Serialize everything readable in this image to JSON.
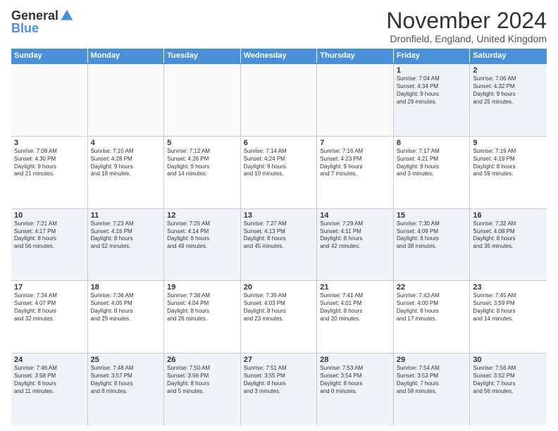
{
  "logo": {
    "general": "General",
    "blue": "Blue"
  },
  "title": "November 2024",
  "location": "Dronfield, England, United Kingdom",
  "days_of_week": [
    "Sunday",
    "Monday",
    "Tuesday",
    "Wednesday",
    "Thursday",
    "Friday",
    "Saturday"
  ],
  "rows": [
    {
      "cells": [
        {
          "day": "",
          "empty": true,
          "lines": []
        },
        {
          "day": "",
          "empty": true,
          "lines": []
        },
        {
          "day": "",
          "empty": true,
          "lines": []
        },
        {
          "day": "",
          "empty": true,
          "lines": []
        },
        {
          "day": "",
          "empty": true,
          "lines": []
        },
        {
          "day": "1",
          "empty": false,
          "lines": [
            "Sunrise: 7:04 AM",
            "Sunset: 4:34 PM",
            "Daylight: 9 hours",
            "and 29 minutes."
          ]
        },
        {
          "day": "2",
          "empty": false,
          "lines": [
            "Sunrise: 7:06 AM",
            "Sunset: 4:32 PM",
            "Daylight: 9 hours",
            "and 25 minutes."
          ]
        }
      ]
    },
    {
      "cells": [
        {
          "day": "3",
          "empty": false,
          "lines": [
            "Sunrise: 7:08 AM",
            "Sunset: 4:30 PM",
            "Daylight: 9 hours",
            "and 21 minutes."
          ]
        },
        {
          "day": "4",
          "empty": false,
          "lines": [
            "Sunrise: 7:10 AM",
            "Sunset: 4:28 PM",
            "Daylight: 9 hours",
            "and 18 minutes."
          ]
        },
        {
          "day": "5",
          "empty": false,
          "lines": [
            "Sunrise: 7:12 AM",
            "Sunset: 4:26 PM",
            "Daylight: 9 hours",
            "and 14 minutes."
          ]
        },
        {
          "day": "6",
          "empty": false,
          "lines": [
            "Sunrise: 7:14 AM",
            "Sunset: 4:24 PM",
            "Daylight: 9 hours",
            "and 10 minutes."
          ]
        },
        {
          "day": "7",
          "empty": false,
          "lines": [
            "Sunrise: 7:16 AM",
            "Sunset: 4:23 PM",
            "Daylight: 9 hours",
            "and 7 minutes."
          ]
        },
        {
          "day": "8",
          "empty": false,
          "lines": [
            "Sunrise: 7:17 AM",
            "Sunset: 4:21 PM",
            "Daylight: 9 hours",
            "and 3 minutes."
          ]
        },
        {
          "day": "9",
          "empty": false,
          "lines": [
            "Sunrise: 7:19 AM",
            "Sunset: 4:19 PM",
            "Daylight: 8 hours",
            "and 59 minutes."
          ]
        }
      ]
    },
    {
      "cells": [
        {
          "day": "10",
          "empty": false,
          "lines": [
            "Sunrise: 7:21 AM",
            "Sunset: 4:17 PM",
            "Daylight: 8 hours",
            "and 56 minutes."
          ]
        },
        {
          "day": "11",
          "empty": false,
          "lines": [
            "Sunrise: 7:23 AM",
            "Sunset: 4:16 PM",
            "Daylight: 8 hours",
            "and 52 minutes."
          ]
        },
        {
          "day": "12",
          "empty": false,
          "lines": [
            "Sunrise: 7:25 AM",
            "Sunset: 4:14 PM",
            "Daylight: 8 hours",
            "and 49 minutes."
          ]
        },
        {
          "day": "13",
          "empty": false,
          "lines": [
            "Sunrise: 7:27 AM",
            "Sunset: 4:13 PM",
            "Daylight: 8 hours",
            "and 45 minutes."
          ]
        },
        {
          "day": "14",
          "empty": false,
          "lines": [
            "Sunrise: 7:29 AM",
            "Sunset: 4:11 PM",
            "Daylight: 8 hours",
            "and 42 minutes."
          ]
        },
        {
          "day": "15",
          "empty": false,
          "lines": [
            "Sunrise: 7:30 AM",
            "Sunset: 4:09 PM",
            "Daylight: 8 hours",
            "and 38 minutes."
          ]
        },
        {
          "day": "16",
          "empty": false,
          "lines": [
            "Sunrise: 7:32 AM",
            "Sunset: 4:08 PM",
            "Daylight: 8 hours",
            "and 35 minutes."
          ]
        }
      ]
    },
    {
      "cells": [
        {
          "day": "17",
          "empty": false,
          "lines": [
            "Sunrise: 7:34 AM",
            "Sunset: 4:07 PM",
            "Daylight: 8 hours",
            "and 32 minutes."
          ]
        },
        {
          "day": "18",
          "empty": false,
          "lines": [
            "Sunrise: 7:36 AM",
            "Sunset: 4:05 PM",
            "Daylight: 8 hours",
            "and 29 minutes."
          ]
        },
        {
          "day": "19",
          "empty": false,
          "lines": [
            "Sunrise: 7:38 AM",
            "Sunset: 4:04 PM",
            "Daylight: 8 hours",
            "and 26 minutes."
          ]
        },
        {
          "day": "20",
          "empty": false,
          "lines": [
            "Sunrise: 7:39 AM",
            "Sunset: 4:03 PM",
            "Daylight: 8 hours",
            "and 23 minutes."
          ]
        },
        {
          "day": "21",
          "empty": false,
          "lines": [
            "Sunrise: 7:41 AM",
            "Sunset: 4:01 PM",
            "Daylight: 8 hours",
            "and 20 minutes."
          ]
        },
        {
          "day": "22",
          "empty": false,
          "lines": [
            "Sunrise: 7:43 AM",
            "Sunset: 4:00 PM",
            "Daylight: 8 hours",
            "and 17 minutes."
          ]
        },
        {
          "day": "23",
          "empty": false,
          "lines": [
            "Sunrise: 7:45 AM",
            "Sunset: 3:59 PM",
            "Daylight: 8 hours",
            "and 14 minutes."
          ]
        }
      ]
    },
    {
      "cells": [
        {
          "day": "24",
          "empty": false,
          "lines": [
            "Sunrise: 7:46 AM",
            "Sunset: 3:58 PM",
            "Daylight: 8 hours",
            "and 11 minutes."
          ]
        },
        {
          "day": "25",
          "empty": false,
          "lines": [
            "Sunrise: 7:48 AM",
            "Sunset: 3:57 PM",
            "Daylight: 8 hours",
            "and 8 minutes."
          ]
        },
        {
          "day": "26",
          "empty": false,
          "lines": [
            "Sunrise: 7:50 AM",
            "Sunset: 3:56 PM",
            "Daylight: 8 hours",
            "and 5 minutes."
          ]
        },
        {
          "day": "27",
          "empty": false,
          "lines": [
            "Sunrise: 7:51 AM",
            "Sunset: 3:55 PM",
            "Daylight: 8 hours",
            "and 3 minutes."
          ]
        },
        {
          "day": "28",
          "empty": false,
          "lines": [
            "Sunrise: 7:53 AM",
            "Sunset: 3:54 PM",
            "Daylight: 8 hours",
            "and 0 minutes."
          ]
        },
        {
          "day": "29",
          "empty": false,
          "lines": [
            "Sunrise: 7:54 AM",
            "Sunset: 3:53 PM",
            "Daylight: 7 hours",
            "and 58 minutes."
          ]
        },
        {
          "day": "30",
          "empty": false,
          "lines": [
            "Sunrise: 7:56 AM",
            "Sunset: 3:52 PM",
            "Daylight: 7 hours",
            "and 56 minutes."
          ]
        }
      ]
    }
  ]
}
